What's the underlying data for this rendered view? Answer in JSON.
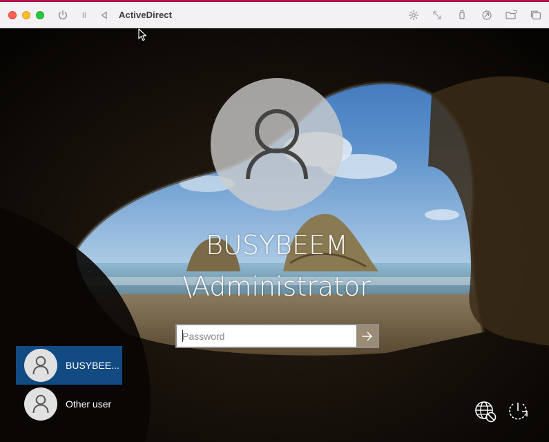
{
  "vm_window": {
    "title": "ActiveDirect",
    "toolbar_icons": [
      "power-icon",
      "pause-icon",
      "back-triangle-icon",
      "brightness-icon",
      "resize-arrows-icon",
      "usb-icon",
      "network-sharing-icon",
      "shared-folder-icon",
      "windows-icon"
    ]
  },
  "login": {
    "user_name": "BUSYBEEM \\Administrator",
    "password_placeholder": "Password",
    "password_value": ""
  },
  "user_tiles": [
    {
      "label": "BUSYBEE...",
      "selected": true
    },
    {
      "label": "Other user",
      "selected": false
    }
  ],
  "system_buttons": [
    "network-icon",
    "power-icon"
  ],
  "colors": {
    "selected_tile": "#124a82",
    "submit_button": "#9a8c76",
    "title_accent": "#b0144e"
  }
}
